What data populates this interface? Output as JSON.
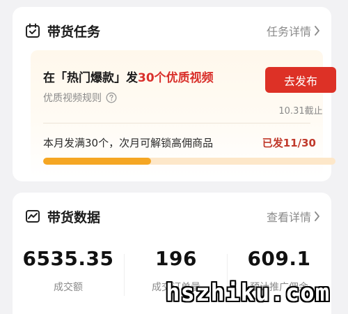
{
  "task_card": {
    "title": "带货任务",
    "detail_link": "任务详情",
    "task_title_prefix": "在「热门爆款」发",
    "task_title_highlight": "30个优质视频",
    "rules_link": "优质视频规则",
    "publish_button": "去发布",
    "deadline": "10.31截止",
    "goal_text": "本月发满30个，次月可解锁高佣商品",
    "sent_status": "已发11/30",
    "progress_fraction": 0.37
  },
  "data_card": {
    "title": "带货数据",
    "detail_link": "查看详情",
    "metrics": [
      {
        "value": "6535.35",
        "label": "成交额"
      },
      {
        "value": "196",
        "label": "成交订单量"
      },
      {
        "value": "609.1",
        "label": "预计推广佣金"
      }
    ]
  },
  "watermark": "hszhiku.com",
  "colors": {
    "accent_red": "#dd3126",
    "progress_fill": "#f5a623",
    "progress_track": "#fde7c9"
  },
  "icons": {
    "task_icon": "calendar-check-icon",
    "data_icon": "line-chart-icon",
    "rules_icon": "question-circle-icon",
    "link_icon": "chevron-right-icon"
  }
}
